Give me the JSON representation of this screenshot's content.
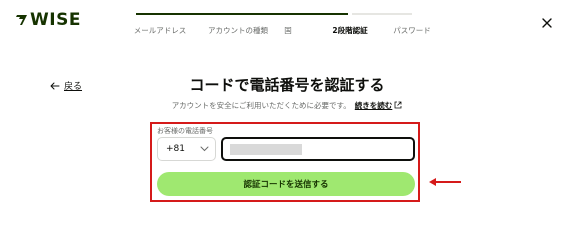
{
  "brand": {
    "logo_text": "WISE"
  },
  "steps": [
    {
      "label": "メールアドレス",
      "state": "done"
    },
    {
      "label": "アカウントの種類",
      "state": "done"
    },
    {
      "label": "国",
      "state": "done"
    },
    {
      "label": "2段階認証",
      "state": "current"
    },
    {
      "label": "パスワード",
      "state": "pending"
    }
  ],
  "header": {
    "close_icon": "close-icon"
  },
  "nav": {
    "back_label": "戻る",
    "back_icon": "arrow-left-icon"
  },
  "main": {
    "title": "コードで電話番号を認証する",
    "subtitle": "アカウントを安全にご利用いただくために必要です。",
    "learn_more_label": "続きを読む",
    "learn_more_icon": "external-link-icon"
  },
  "form": {
    "phone_label": "お客様の電話番号",
    "country_code": "+81",
    "phone_value": "",
    "submit_label": "認証コードを送信する"
  },
  "colors": {
    "brand_green": "#9fe870",
    "brand_dark": "#163300",
    "highlight_red": "#d51a1a"
  }
}
